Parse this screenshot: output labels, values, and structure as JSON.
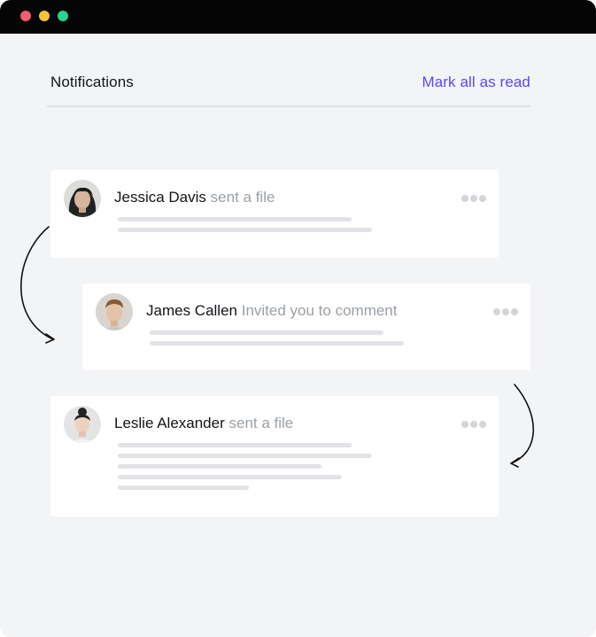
{
  "header": {
    "title": "Notifications",
    "action_label": "Mark all as read"
  },
  "notifications": [
    {
      "name": "Jessica Davis",
      "action": "sent a file"
    },
    {
      "name": "James Callen",
      "action": "Invited you to comment"
    },
    {
      "name": "Leslie Alexander",
      "action": "sent a file"
    }
  ],
  "colors": {
    "accent": "#5b47f5",
    "titlebar": "#050505",
    "background": "#f3f4f6",
    "muted_text": "#9aa0a6"
  },
  "icons": {
    "window_controls": [
      "close-dot",
      "minimize-dot",
      "maximize-dot"
    ],
    "menu": "more-dots-icon",
    "flow": "curved-arrow-icon"
  }
}
